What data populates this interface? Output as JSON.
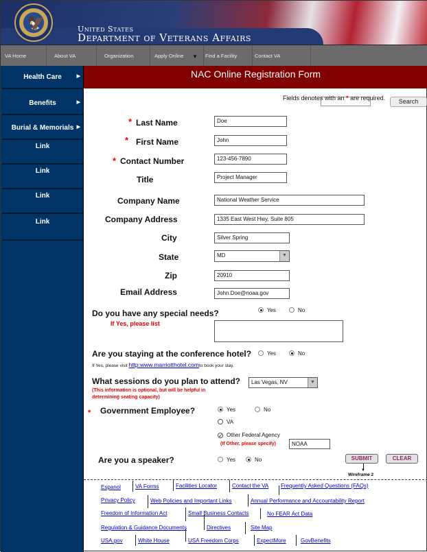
{
  "header": {
    "agency_line1": "United States",
    "agency_line2": "Department of Veterans Affairs",
    "seal": "VA seal"
  },
  "nav": {
    "items": [
      "VA Home",
      "About VA",
      "Organization",
      "Apply Online",
      "Find a Facility",
      "Contact VA"
    ],
    "search_value": "",
    "search_button": "Search"
  },
  "sidebar": {
    "items": [
      {
        "label": "Health Care"
      },
      {
        "label": "Benefits"
      },
      {
        "label": "Burial & Memorials"
      },
      {
        "label": "Link"
      },
      {
        "label": "Link"
      },
      {
        "label": "Link"
      },
      {
        "label": "Link"
      }
    ]
  },
  "form": {
    "title": "NAC Online Registration Form",
    "required_note_pre": "Fields denotes with an ",
    "required_note_star": "*",
    "required_note_post": " are required.",
    "fields": {
      "last_name": {
        "label": "Last Name",
        "value": "Doe",
        "required": true
      },
      "first_name": {
        "label": "First Name",
        "value": "John",
        "required": true
      },
      "contact_number": {
        "label": "Contact Number",
        "value": "123-456-7890",
        "required": true
      },
      "title": {
        "label": "Title",
        "value": "Project Manager"
      },
      "company_name": {
        "label": "Company Name",
        "value": "National Weather Service"
      },
      "company_address": {
        "label": "Company Address",
        "value": "1335 East West Hwy, Suite 805"
      },
      "city": {
        "label": "City",
        "value": "Silver Spring"
      },
      "state": {
        "label": "State",
        "value": "MD"
      },
      "zip": {
        "label": "Zip",
        "value": "20910"
      },
      "email": {
        "label": "Email Address",
        "value": "John.Doe@noaa.gov"
      }
    },
    "special_needs": {
      "question": "Do you have any special needs?",
      "yes": "Yes",
      "no": "No",
      "selected": "Yes",
      "list_label": "If Yes, please list",
      "list_value": ""
    },
    "hotel": {
      "question": "Are you staying at the conference hotel?",
      "yes": "Yes",
      "no": "No",
      "selected": "No",
      "note_pre": "If Yes, please visit ",
      "link": "http:www.marriotthotel.com",
      "note_post": "to book your stay."
    },
    "sessions": {
      "question": "What sessions do you plan to attend?",
      "value": "Las Vegas, NV",
      "note_line1": "(This information is optional, but will be helpful in",
      "note_line2": "determining seating capacity)"
    },
    "gov_employee": {
      "question": "Government Employee?",
      "required": true,
      "yes": "Yes",
      "no": "No",
      "selected": "Yes",
      "va_label": "VA",
      "va_checked": false,
      "other_label": "Other Federal Agency",
      "other_checked": true,
      "other_hint": "(If Other, please specify)",
      "other_value": "NOAA"
    },
    "speaker": {
      "question": "Are you a speaker?",
      "yes": "Yes",
      "no": "No",
      "selected": "No"
    },
    "submit": "SUBMIT",
    "clear": "CLEAR",
    "annotation": "Wireframe 2"
  },
  "footer": {
    "links": [
      "Espanol",
      "VA Forms",
      "Facilities Locator",
      "Contact the VA",
      "Frequently Asked Questions (FAQs)",
      "Privacy Policy",
      "Web Policies and Important Links",
      "Annual Performance and Accountability Report",
      "Freedom of Information Act",
      "Small Business Contacts",
      "No FEAR Act Data",
      "Regulation & Guidance Documents",
      "Directives",
      "Site Map",
      "USA.gov",
      "White House",
      "USA Freedom Corps",
      "ExpectMore",
      "GovBenefits"
    ]
  }
}
